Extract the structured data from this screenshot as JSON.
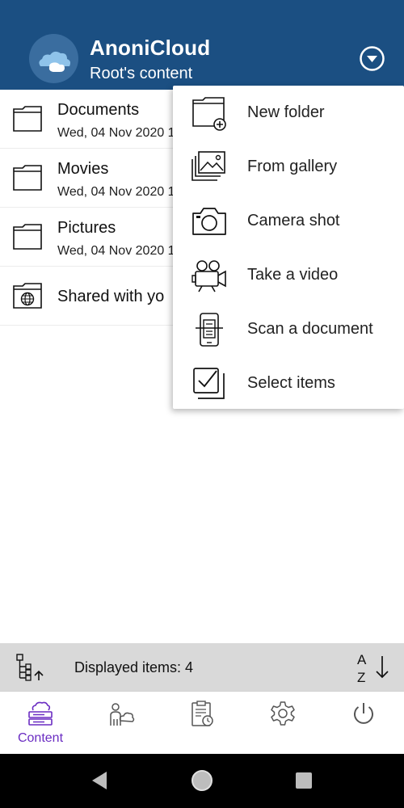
{
  "header": {
    "title": "AnoniCloud",
    "subtitle": "Root's content"
  },
  "items": [
    {
      "name": "Documents",
      "date": "Wed, 04 Nov 2020 1",
      "icon": "folder-icon"
    },
    {
      "name": "Movies",
      "date": "Wed, 04 Nov 2020 1",
      "icon": "folder-icon"
    },
    {
      "name": "Pictures",
      "date": "Wed, 04 Nov 2020 1",
      "icon": "folder-icon"
    },
    {
      "name": "Shared with yo",
      "icon": "shared-folder-icon"
    }
  ],
  "menu": {
    "items": [
      {
        "label": "New folder",
        "icon": "new-folder-icon"
      },
      {
        "label": "From gallery",
        "icon": "gallery-icon"
      },
      {
        "label": "Camera shot",
        "icon": "camera-icon"
      },
      {
        "label": "Take a video",
        "icon": "video-camera-icon"
      },
      {
        "label": "Scan a document",
        "icon": "scan-document-icon"
      },
      {
        "label": "Select items",
        "icon": "select-items-icon"
      }
    ]
  },
  "status": {
    "displayed_items": "Displayed items: 4",
    "sort_top": "A",
    "sort_bottom": "Z"
  },
  "bottom_nav": {
    "content_label": "Content",
    "active_color": "#6a2cc2"
  },
  "colors": {
    "header_bg": "#1b4f82",
    "statusbar_bg": "#d9d9d9"
  }
}
